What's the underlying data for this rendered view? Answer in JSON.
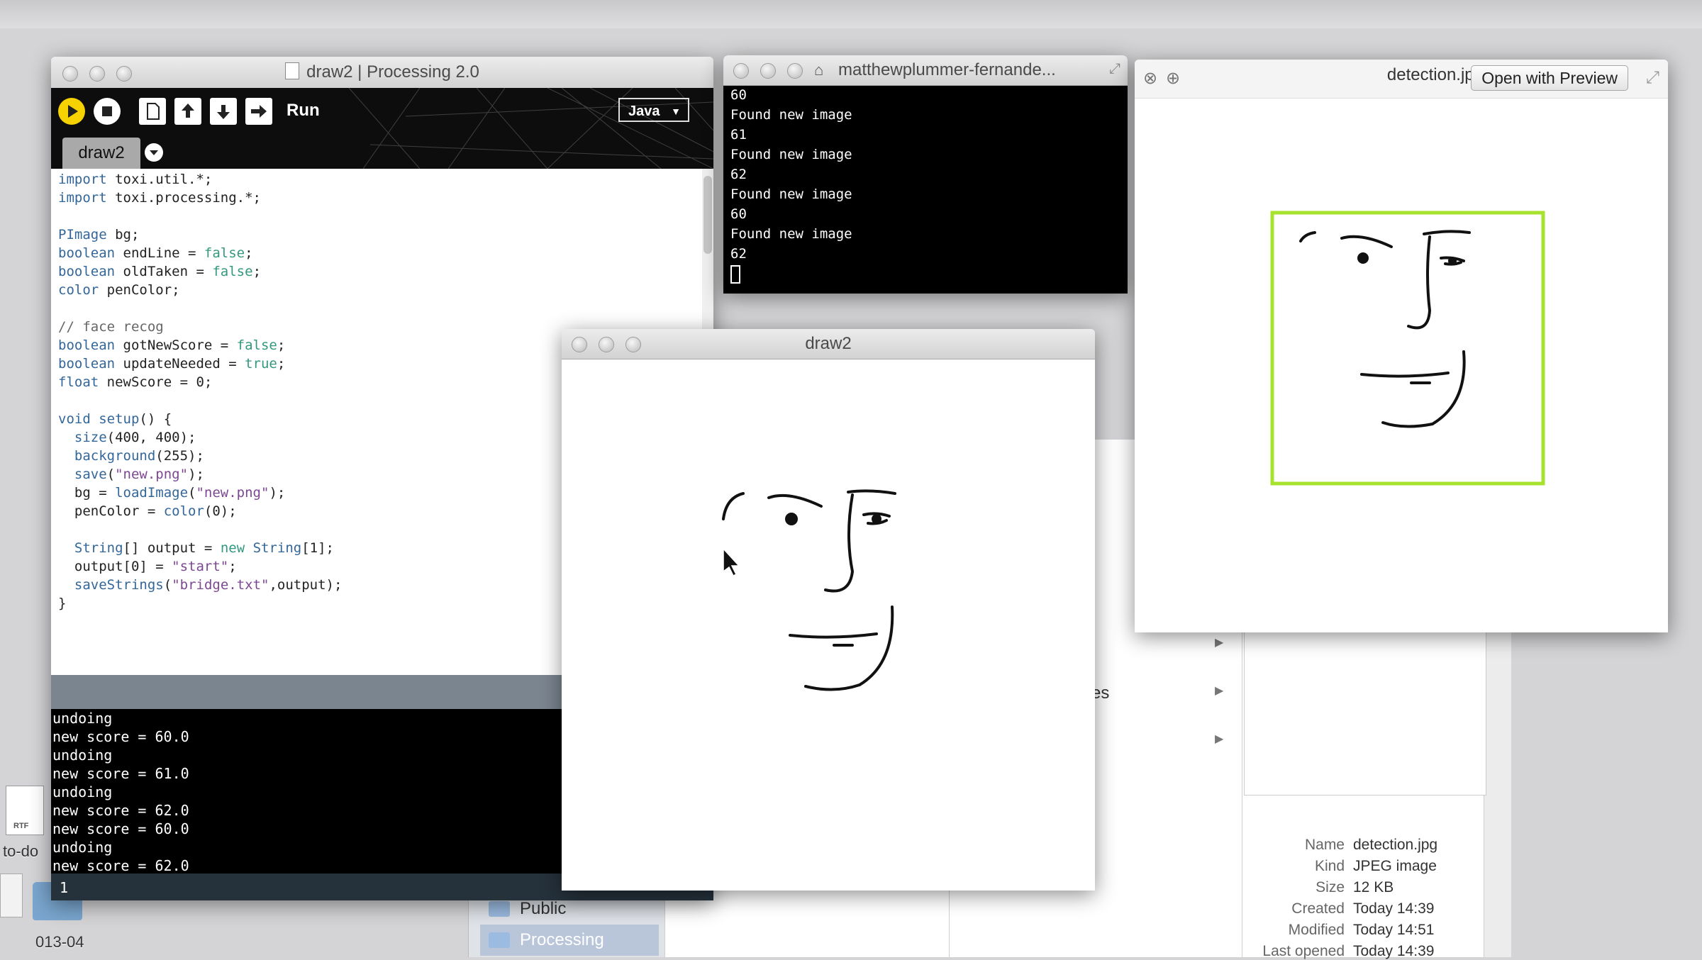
{
  "desktop": {
    "file_badge": "RTF",
    "file_label": "to-do",
    "folder_label": "013-04"
  },
  "finder": {
    "sidebar": [
      {
        "label": "Public"
      },
      {
        "label": "Processing"
      }
    ],
    "partial_text": "es",
    "info": {
      "name_label": "Name",
      "name_value": "detection.jpg",
      "kind_label": "Kind",
      "kind_value": "JPEG image",
      "size_label": "Size",
      "size_value": "12 KB",
      "created_label": "Created",
      "created_value": "Today 14:39",
      "modified_label": "Modified",
      "modified_value": "Today 14:51",
      "opened_label": "Last opened",
      "opened_value": "Today 14:39"
    }
  },
  "ide": {
    "window_title": "draw2 | Processing 2.0",
    "run_label": "Run",
    "mode": "Java",
    "tab": "draw2",
    "code": [
      "import toxi.util.*;",
      "import toxi.processing.*;",
      "",
      "PImage bg;",
      "boolean endLine = false;",
      "boolean oldTaken = false;",
      "color penColor;",
      "",
      "// face recog",
      "boolean gotNewScore = false;",
      "boolean updateNeeded = true;",
      "float newScore = 0;",
      "",
      "void setup() {",
      "  size(400, 400);",
      "  background(255);",
      "  save(\"new.png\");",
      "  bg = loadImage(\"new.png\");",
      "  penColor = color(0);",
      "",
      "  String[] output = new String[1];",
      "  output[0] = \"start\";",
      "  saveStrings(\"bridge.txt\",output);",
      "}"
    ],
    "console": [
      "undoing",
      "new score = 60.0",
      "undoing",
      "new score = 61.0",
      "undoing",
      "new score = 62.0",
      "new score = 60.0",
      "undoing",
      "new score = 62.0"
    ],
    "line_number": "1"
  },
  "terminal": {
    "title": "matthewplummer-fernande...",
    "lines": [
      "60",
      "Found new image",
      "61",
      "Found new image",
      "62",
      "Found new image",
      "60",
      "Found new image",
      "62"
    ]
  },
  "quicklook": {
    "title": "detection.jpg",
    "open_button": "Open with Preview",
    "box_color": "#a6e22e"
  },
  "sketch": {
    "title": "draw2"
  }
}
